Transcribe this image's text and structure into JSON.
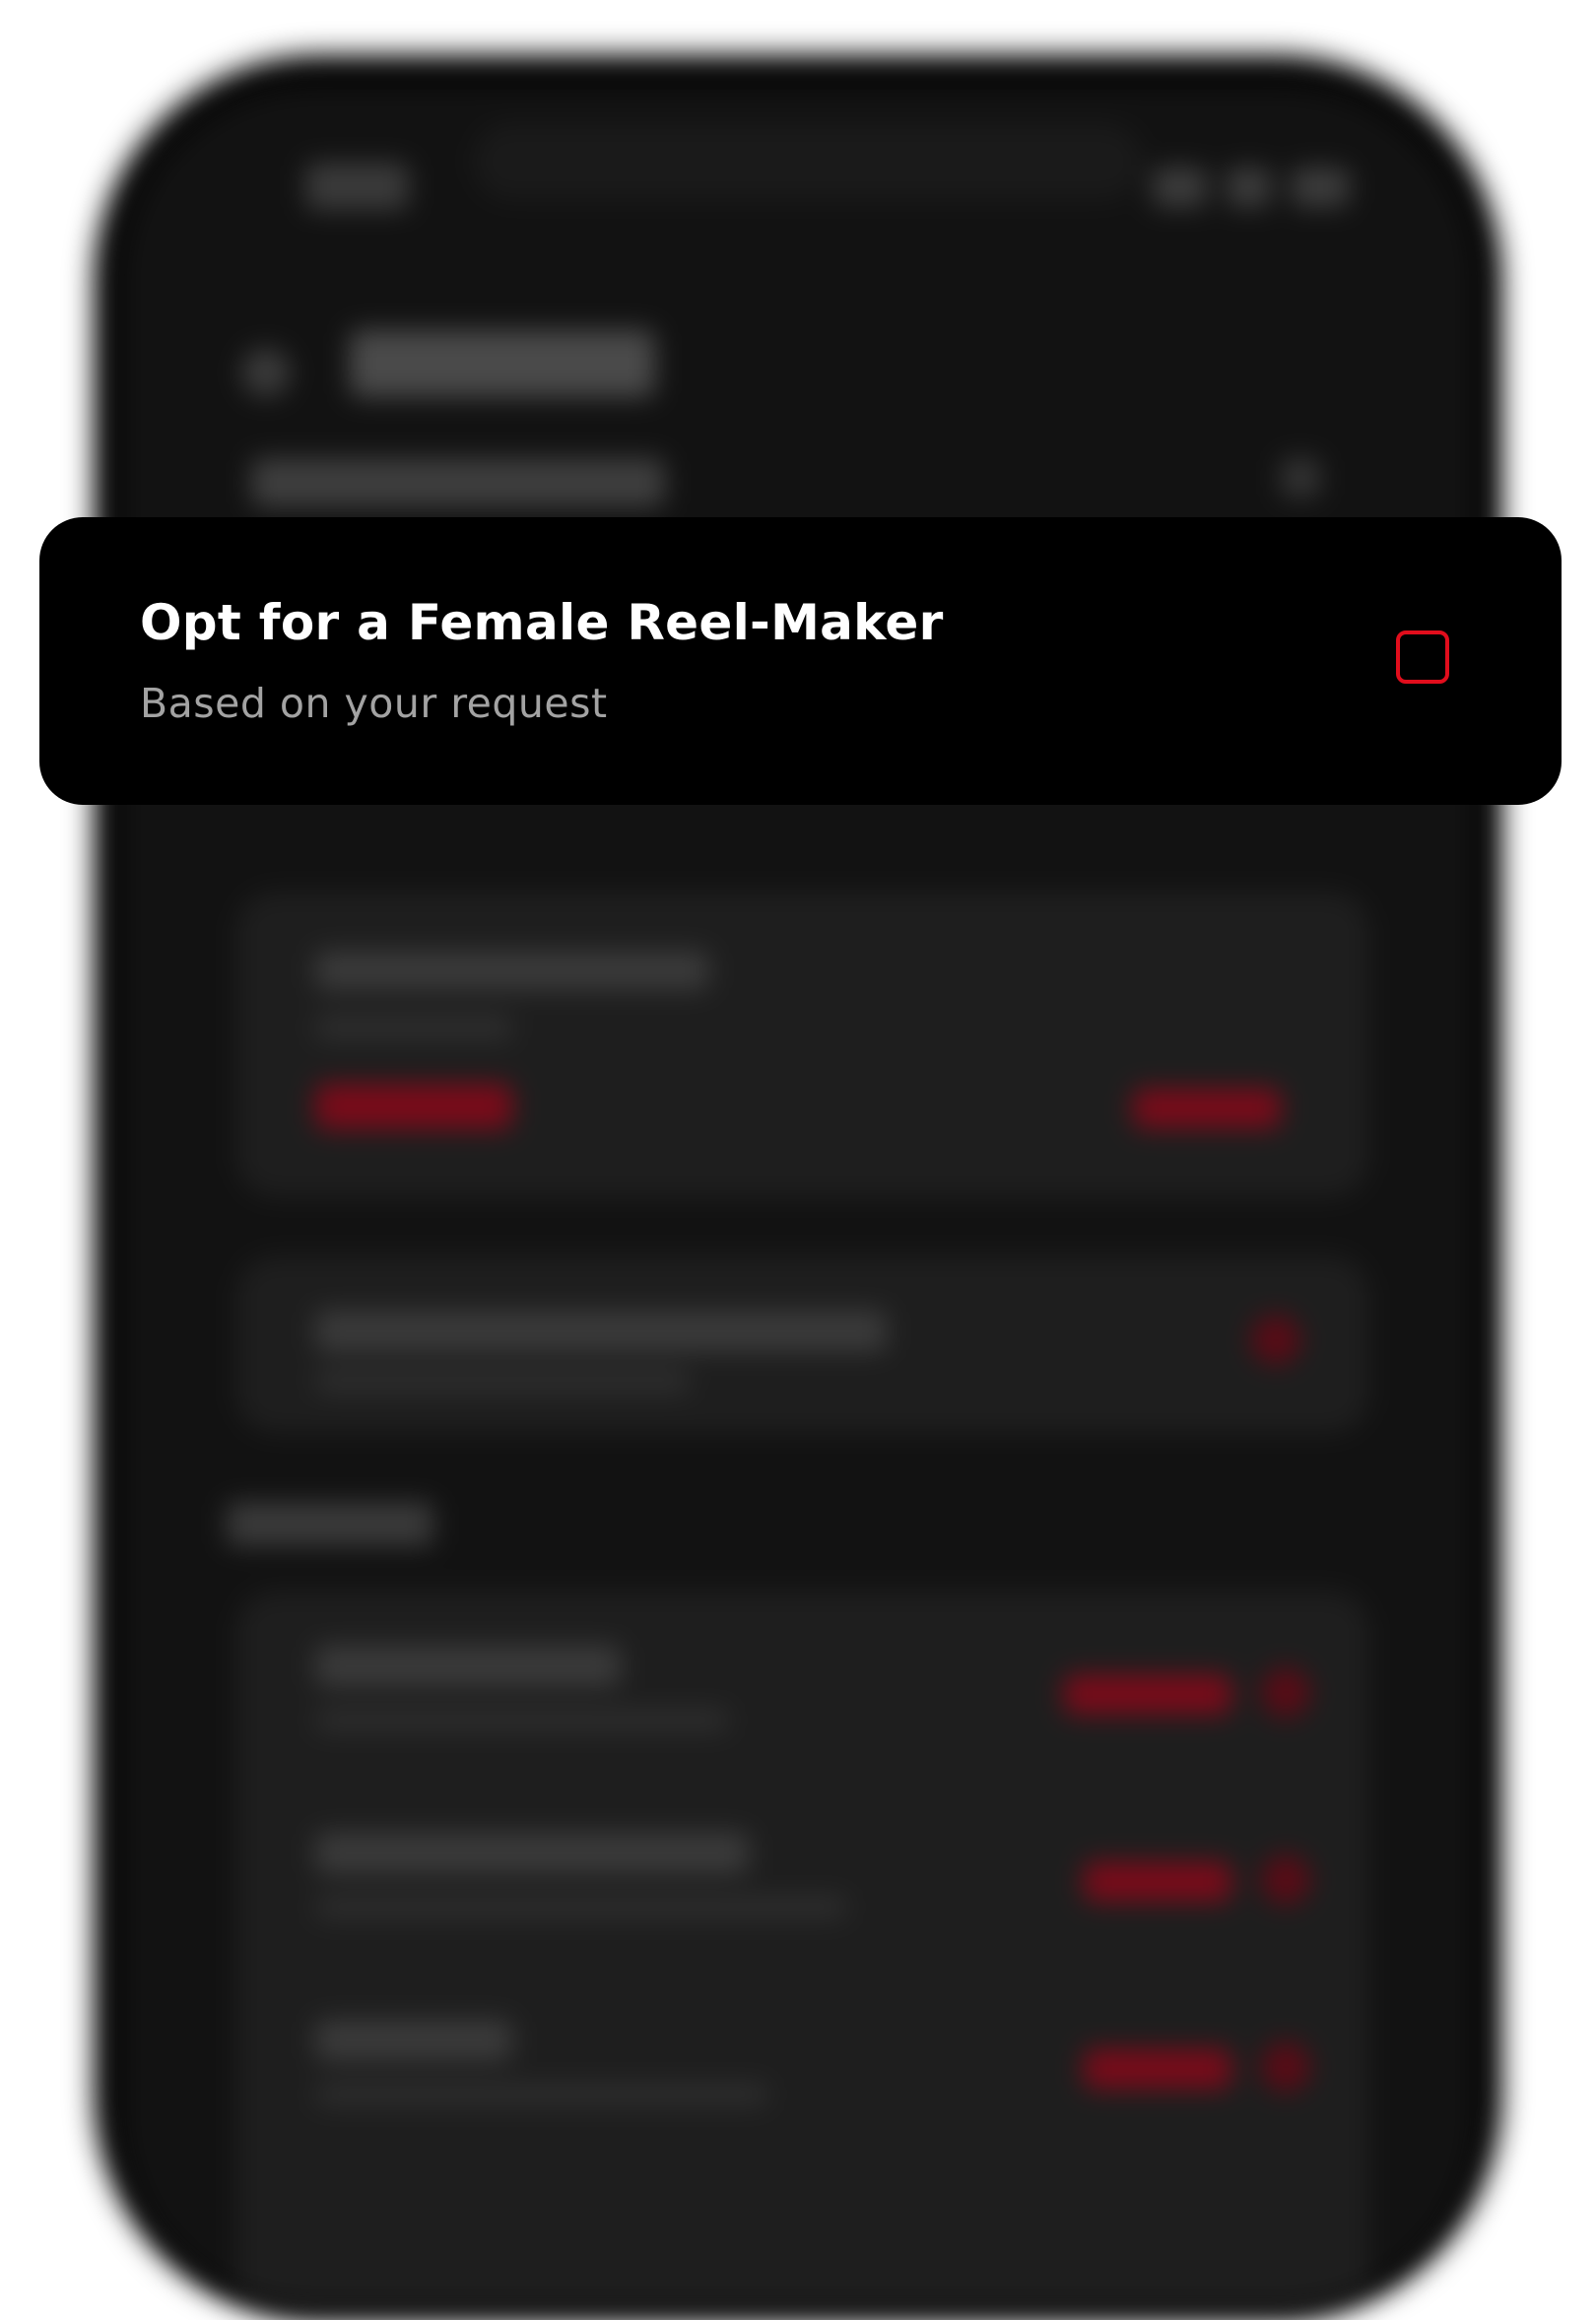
{
  "option_card": {
    "title": "Opt for a Female Reel-Maker",
    "subtitle": "Based on your request",
    "checked": false,
    "accent_color": "#e10d1c"
  },
  "colors": {
    "page_background": "#ffffff",
    "card_background": "#000000",
    "title_text": "#ffffff",
    "subtitle_text": "#a3a3a3"
  }
}
